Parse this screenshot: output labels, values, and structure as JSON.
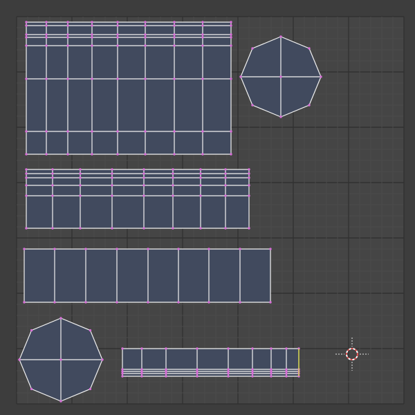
{
  "colors": {
    "background": "#3d3d3d",
    "uv_space": "#454545",
    "grid_minor": "#4a4a4a",
    "grid_major": "#2f2f2f",
    "face_fill": "#414a5e",
    "edge": "#f2f2f2",
    "vertex": "#d870d8",
    "active_edge": "#d6d64a",
    "cursor_red": "#e05050",
    "cursor_white": "#ffffff"
  },
  "icons": {
    "cursor": "2d-cursor-icon"
  }
}
